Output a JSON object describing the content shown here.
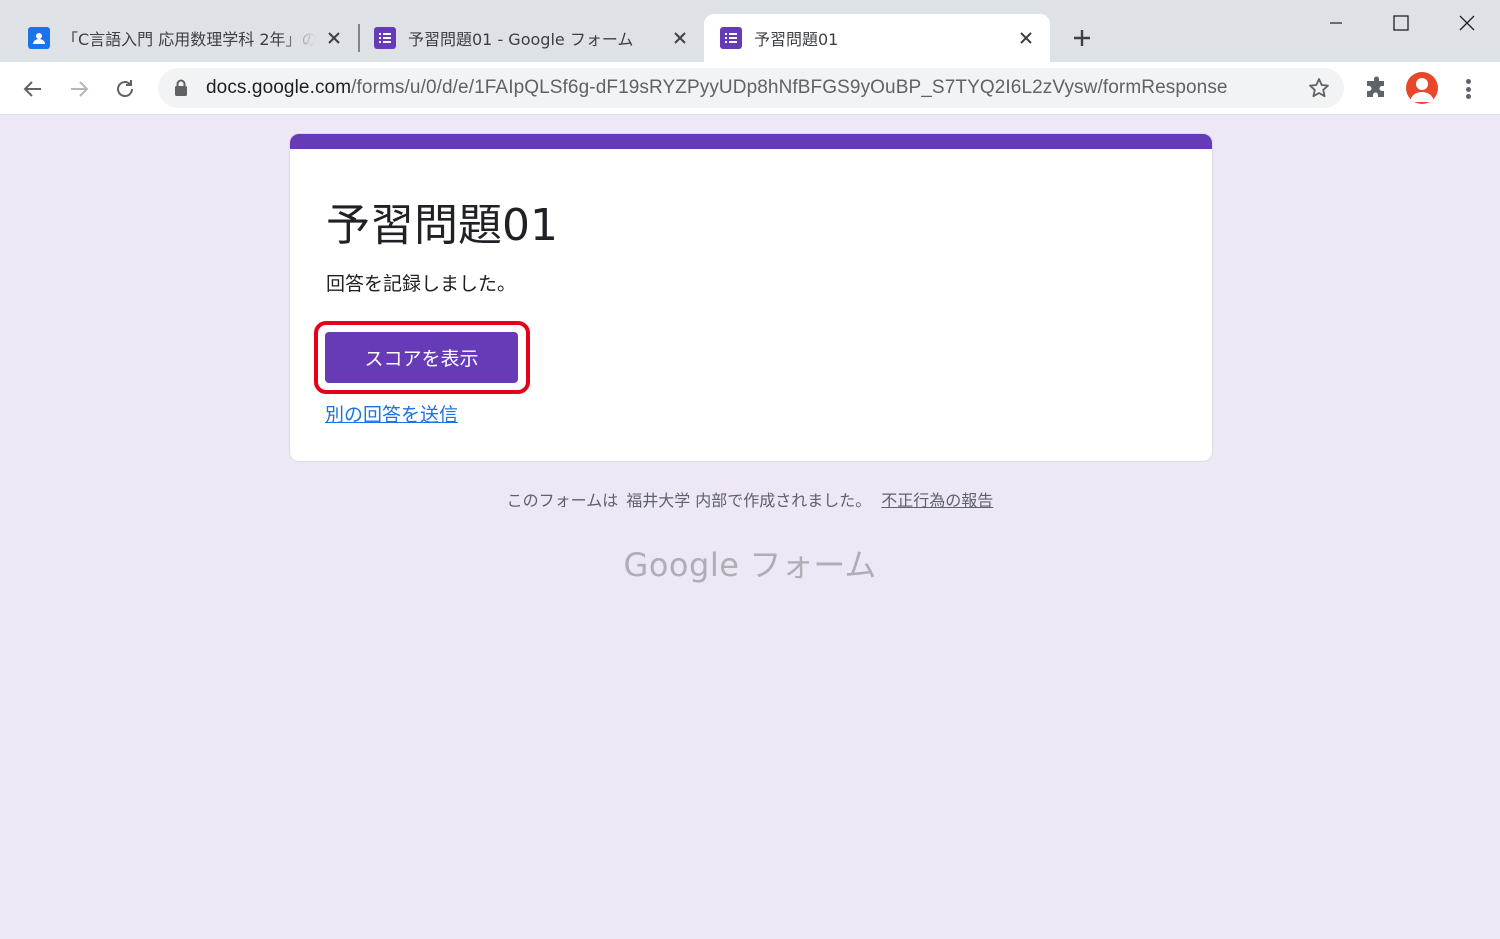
{
  "browser": {
    "tabs": [
      {
        "title": "「C言語入門 応用数理学科 2年」の",
        "icon": "classroom-icon",
        "color": "#1a73e8"
      },
      {
        "title": "予習問題01 - Google フォーム",
        "icon": "forms-icon",
        "color": "#673ab7"
      },
      {
        "title": "予習問題01",
        "icon": "forms-icon",
        "color": "#673ab7",
        "active": true
      }
    ],
    "new_tab_label": "+",
    "url_host": "docs.google.com",
    "url_path": "/forms/u/0/d/e/1FAIpQLSf6g-dF19sRYZPyyUDp8hNfBFGS9yOuBP_S7TYQ2I6L2zVysw/formResponse"
  },
  "form": {
    "accent_color": "#673ab7",
    "title": "予習問題01",
    "confirmation": "回答を記録しました。",
    "view_score_label": "スコアを表示",
    "submit_another_label": "別の回答を送信",
    "highlight_color": "#e6001a"
  },
  "footer": {
    "created_text": "このフォームは",
    "org": "福井大学 内部で作成されました。",
    "report_label": "不正行為の報告",
    "brand_google": "Google",
    "brand_forms": "フォーム"
  },
  "colors": {
    "page_background": "#ede7f6",
    "link": "#1a73e8"
  }
}
